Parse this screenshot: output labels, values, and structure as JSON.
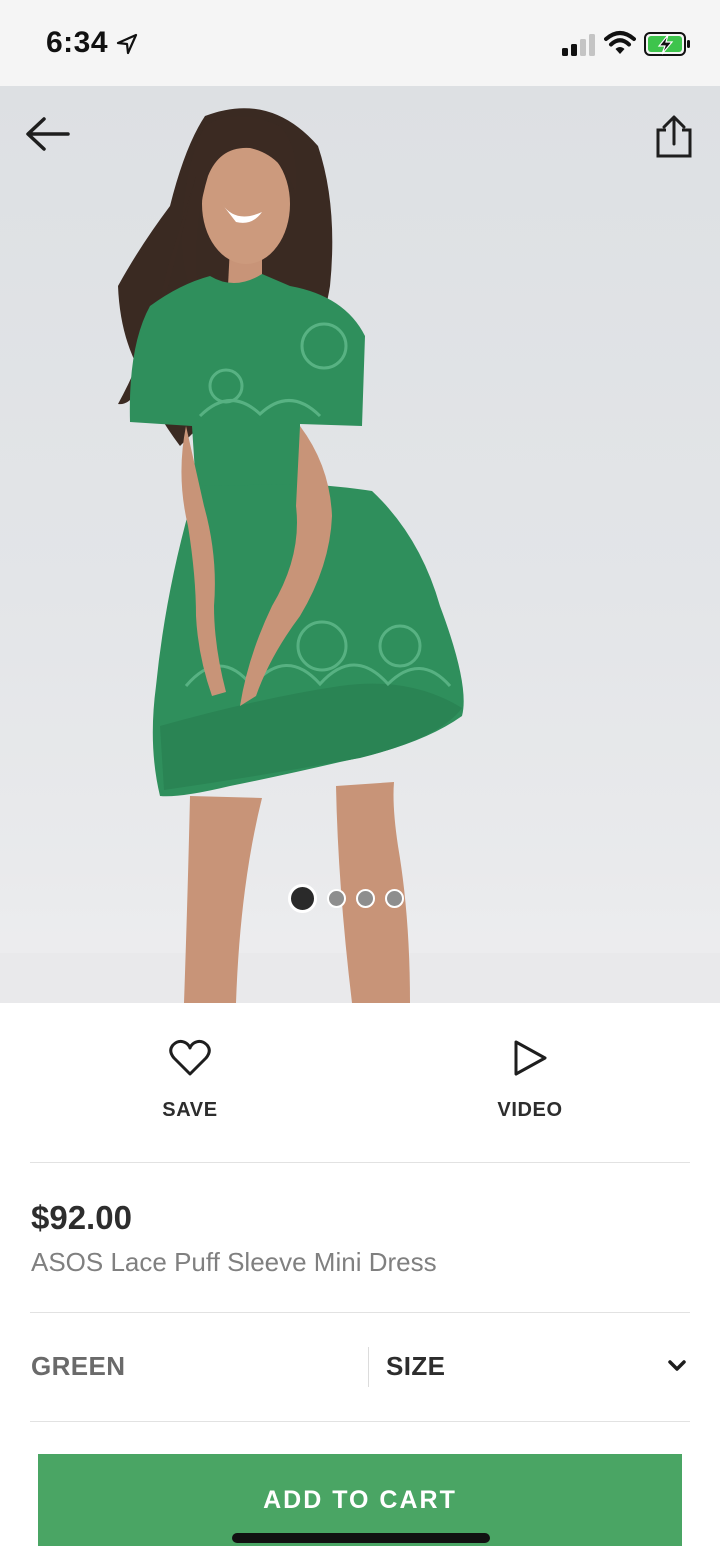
{
  "status_bar": {
    "time": "6:34",
    "icons": [
      "location-arrow-icon",
      "cellular-signal-icon",
      "wifi-icon",
      "battery-charging-icon"
    ]
  },
  "gallery": {
    "image": "green lace puff sleeve mini dress worn by model",
    "dot_count": 4,
    "active_dot": 0,
    "icons": [
      "back-arrow-icon",
      "share-icon"
    ]
  },
  "actions": {
    "save_label": "SAVE",
    "video_label": "VIDEO",
    "icons": [
      "heart-icon",
      "play-icon"
    ]
  },
  "product": {
    "price": "$92.00",
    "name": "ASOS Lace Puff Sleeve Mini Dress"
  },
  "variants": {
    "colour": "GREEN",
    "size_label": "SIZE"
  },
  "cart": {
    "add_label": "ADD TO CART"
  },
  "colors": {
    "accent": "#4aa564",
    "dress": "#2f8f5c",
    "text": "#2d2d2d",
    "muted": "#808080"
  }
}
